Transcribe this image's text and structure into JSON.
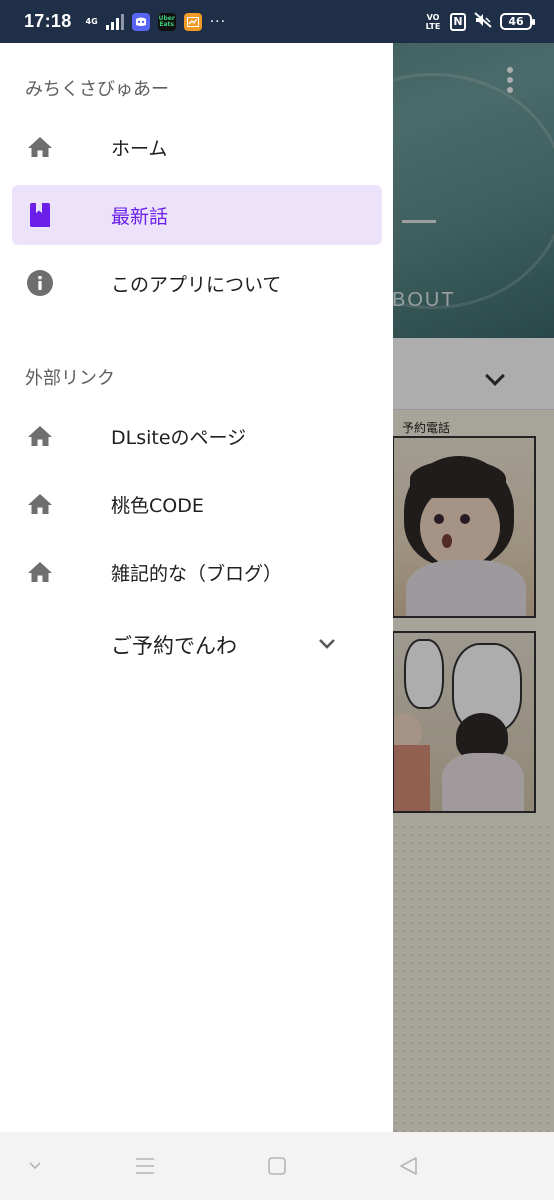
{
  "status_bar": {
    "time": "17:18",
    "network": "4G",
    "app_icons": [
      "discord-icon",
      "uber-eats-icon",
      "chart-app-icon"
    ],
    "uber_label": "Uber Eats",
    "more": "···",
    "volte": "VO LTE",
    "nfc": "N",
    "battery": "46"
  },
  "background": {
    "about_text": "BOUT",
    "comic_title": "予約電話"
  },
  "drawer": {
    "title": "みちくさびゅあー",
    "items": [
      {
        "label": "ホーム",
        "icon": "home-icon",
        "active": false
      },
      {
        "label": "最新話",
        "icon": "book-icon",
        "active": true
      },
      {
        "label": "このアプリについて",
        "icon": "info-icon",
        "active": false
      }
    ],
    "external_header": "外部リンク",
    "external_items": [
      {
        "label": "DLsiteのページ",
        "icon": "home-icon"
      },
      {
        "label": "桃色CODE",
        "icon": "home-icon"
      },
      {
        "label": "雑記的な（ブログ）",
        "icon": "home-icon"
      }
    ],
    "expander": {
      "label": "ご予約でんわ",
      "icon": "chevron-down-icon"
    }
  },
  "colors": {
    "accent": "#6b1fe8",
    "active_bg": "#ece3fb",
    "icon_gray": "#6e6e6e",
    "status_bar": "#1f2f48"
  },
  "system_nav": [
    "chevron-down-icon",
    "menu-icon",
    "home-square-icon",
    "back-icon"
  ]
}
